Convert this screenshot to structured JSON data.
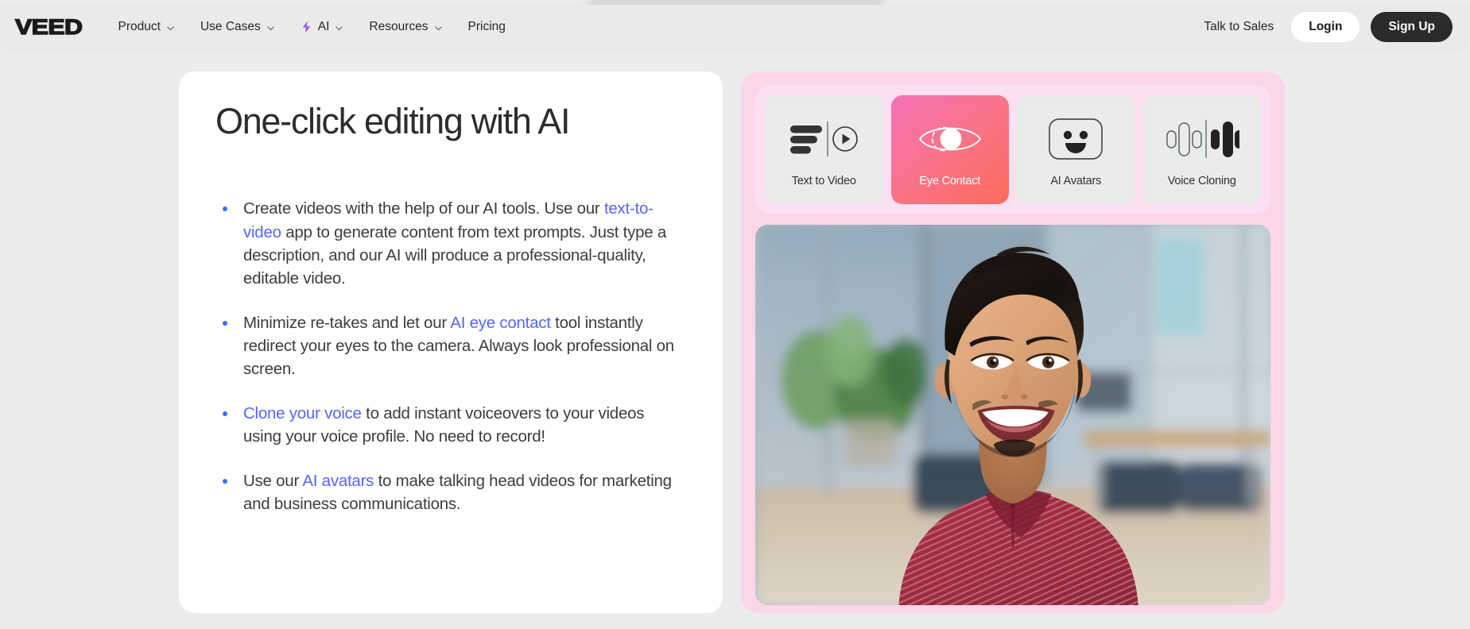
{
  "brand": {
    "name": "VEED"
  },
  "nav": {
    "items": [
      {
        "label": "Product",
        "has_chevron": true,
        "icon": null
      },
      {
        "label": "Use Cases",
        "has_chevron": true,
        "icon": null
      },
      {
        "label": "AI",
        "has_chevron": true,
        "icon": "lightning-bolt-icon"
      },
      {
        "label": "Resources",
        "has_chevron": true,
        "icon": null
      },
      {
        "label": "Pricing",
        "has_chevron": false,
        "icon": null
      }
    ],
    "talk_to_sales": "Talk to Sales",
    "login": "Login",
    "sign_up": "Sign Up"
  },
  "main": {
    "headline": "One-click editing with AI",
    "bullets": [
      {
        "parts": [
          {
            "text": "Create videos with the help of our AI tools. Use our ",
            "link": false
          },
          {
            "text": "text-to-video",
            "link": true
          },
          {
            "text": " app to generate content from text prompts. Just type a description, and our AI will produce a professional-quality, editable video.",
            "link": false
          }
        ]
      },
      {
        "parts": [
          {
            "text": "Minimize re-takes and let our ",
            "link": false
          },
          {
            "text": "AI eye contact",
            "link": true
          },
          {
            "text": " tool instantly redirect your eyes to the camera. Always look professional on screen.",
            "link": false
          }
        ]
      },
      {
        "parts": [
          {
            "text": "Clone your voice",
            "link": true
          },
          {
            "text": " to add instant voiceovers to your videos using your voice profile. No need to record!",
            "link": false
          }
        ]
      },
      {
        "parts": [
          {
            "text": "Use our ",
            "link": false
          },
          {
            "text": "AI avatars",
            "link": true
          },
          {
            "text": " to make talking head videos for marketing and business communications.",
            "link": false
          }
        ]
      }
    ]
  },
  "feature_cards": [
    {
      "label": "Text to Video",
      "icon": "text-to-video-icon",
      "active": false
    },
    {
      "label": "Eye Contact",
      "icon": "eye-contact-icon",
      "active": true
    },
    {
      "label": "AI Avatars",
      "icon": "ai-avatars-icon",
      "active": false
    },
    {
      "label": "Voice Cloning",
      "icon": "voice-cloning-icon",
      "active": false
    }
  ],
  "preview": {
    "alt": "Smiling man in a red striped shirt in a blurred modern office",
    "subject": "person-portrait"
  },
  "colors": {
    "page_background": "#ebecec",
    "navbar_background": "#e9eaea",
    "card_background": "#ffffff",
    "panel_pink_outer": "#fbd6e9",
    "panel_pink_inner": "#fcdff0",
    "feature_card_idle": "#eaebeb",
    "feature_card_active_start": "#f472b6",
    "feature_card_active_end": "#fc6a5a",
    "link": "#5566f5",
    "bullet": "#3b6ef6",
    "ai_bolt": "#8b5cf6",
    "signup_button": "#2b2b2b",
    "text_primary": "#2b2d2f"
  }
}
